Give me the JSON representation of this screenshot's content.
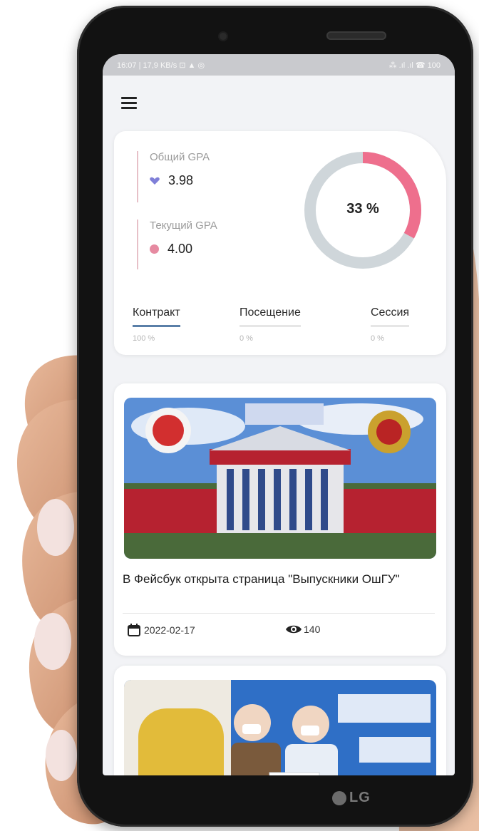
{
  "status_bar": {
    "left": "16:07 | 17,9 KB/s ⊡ ▲ ◎",
    "right": "⁂ .ıl .ıl ☎ 100"
  },
  "gpa": {
    "overall_label": "Общий GPA",
    "overall_value": "3.98",
    "current_label": "Текущий GPA",
    "current_value": "4.00",
    "progress_percent": 33,
    "progress_text": "33 %",
    "colors": {
      "progress": "#ee6f8d",
      "track": "#cfd6da",
      "accent_line": "#e7c0c8",
      "active_tab": "#5a7fa8"
    }
  },
  "tabs": [
    {
      "label": "Контракт",
      "value": "100 %"
    },
    {
      "label": "Посещение",
      "value": "0 %"
    },
    {
      "label": "Сессия",
      "value": "0 %"
    }
  ],
  "news": [
    {
      "title": "В Фейсбук открыта страница \"Выпускники ОшГУ\"",
      "date": "2022-02-17",
      "views": "140"
    }
  ],
  "device_brand": "LG",
  "icons": [
    "menu-icon",
    "heart-icon",
    "dot-icon",
    "calendar-icon",
    "eye-icon"
  ]
}
